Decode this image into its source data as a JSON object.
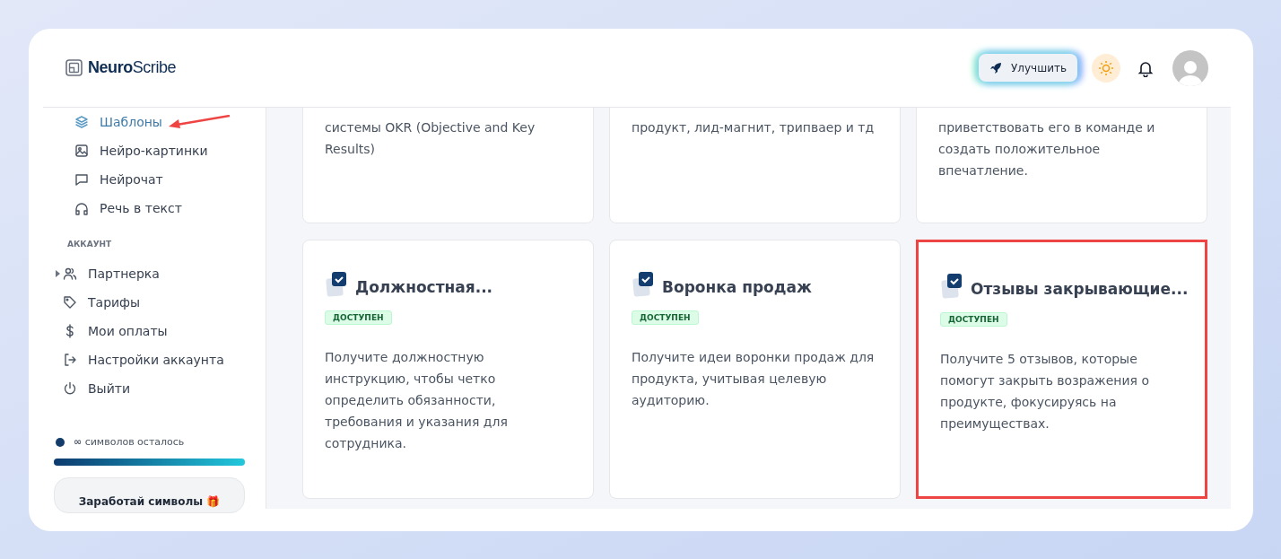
{
  "header": {
    "logo": "**Neuro**Scribe",
    "upgrade_button": "Улучшить"
  },
  "sidebar": {
    "items": [
      {
        "label": "Шаблоны",
        "selected": true,
        "pointed_at": true
      },
      {
        "label": "Нейро-картинки",
        "selected": false,
        "pointed_at": false
      },
      {
        "label": "Нейрочат",
        "selected": false,
        "pointed_at": false
      },
      {
        "label": "Речь в текст",
        "selected": false,
        "pointed_at": false
      }
    ],
    "section_title": "АККАУНТ",
    "account_items": [
      {
        "label": "Партнерка",
        "kind": "group"
      },
      {
        "label": "Тарифы",
        "kind": "link"
      },
      {
        "label": "Мои оплаты",
        "kind": "link"
      },
      {
        "label": "Настройки аккаунта",
        "kind": "link"
      },
      {
        "label": "Выйти",
        "kind": "link"
      }
    ],
    "symbols": {
      "text": "**∞** символов осталось",
      "level": 1
    },
    "earn_button": "Заработай символы 🎁"
  },
  "cards_top": [
    {
      "description": "системы OKR (Objective and Key Results)"
    },
    {
      "description": "продукт, лид-магнит, трипваер и тд"
    },
    {
      "description": "приветствовать его в команде и создать положительное впечатление."
    }
  ],
  "cards": [
    {
      "title": "Должностная...",
      "badge": "ДОСТУПЕН",
      "description": "Получите должностную инструкцию, чтобы четко определить обязанности, требования и указания для сотрудника.",
      "highlighted": false
    },
    {
      "title": "Воронка продаж",
      "badge": "ДОСТУПЕН",
      "description": "Получите идеи воронки продаж для продукта, учитывая целевую аудиторию.",
      "highlighted": false
    },
    {
      "title": "Отзывы закрывающие...",
      "badge": "ДОСТУПЕН",
      "description": "Получите 5 отзывов, которые помогут закрыть возражения о продукте, фокусируясь на преимуществах.",
      "highlighted": true
    }
  ]
}
